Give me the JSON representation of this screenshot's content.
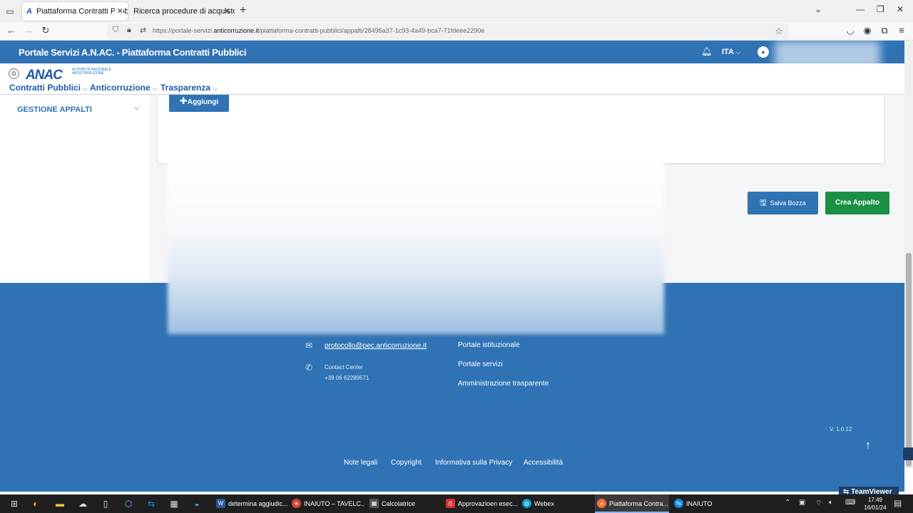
{
  "browser": {
    "tabs": [
      {
        "title": "Piattaforma Contratti Pubblici |",
        "active": true
      },
      {
        "title": "Ricerca procedure di acquisto",
        "active": false
      }
    ],
    "url_prefix": "https://portale-servizi.",
    "url_domain": "anticorruzione.it",
    "url_path": "/piattaforma-contratti-pubblici/appalti/28496a37-1c93-4a49-bca7-71fdeee2290e"
  },
  "header": {
    "title": "Portale Servizi A.N.AC. - Piattaforma Contratti Pubblici",
    "lang": "ITA"
  },
  "subheader": {
    "logo": "ANAC",
    "logo_sub": "AUTORITÀ NAZIONALE ANTICORRUZIONE",
    "menu": [
      "Contratti Pubblici",
      "Anticorruzione",
      "Trasparenza"
    ]
  },
  "sidebar": {
    "section": "GESTIONE APPALTI"
  },
  "main": {
    "add_button": "Aggiungi",
    "save_draft_button": "Salva Bozza",
    "create_button": "Crea Appalto"
  },
  "footer": {
    "email": "protocollo@pec.anticorruzione.it",
    "contact_label": "Contact Center",
    "contact_phone": "+39 06 62289571",
    "links": [
      "Portale istituzionale",
      "Portale servizi",
      "Amministrazione trasparente"
    ],
    "version": "V. 1.0.12",
    "bottom_links": [
      "Note legali",
      "Copyright",
      "Informativa sulla Privacy",
      "Accessibilità"
    ],
    "teamviewer": "TeamViewer"
  },
  "taskbar": {
    "apps": [
      {
        "label": "determina aggiudic...",
        "icon": "word-icon",
        "color": "#2b579a"
      },
      {
        "label": "INAIUTO – TAVELC...",
        "icon": "chrome-icon",
        "color": "#db4437"
      },
      {
        "label": "Calcolatrice",
        "icon": "calculator-icon",
        "color": "#555555"
      },
      {
        "label": "Approvazioen esec...",
        "icon": "pdf-icon",
        "color": "#d32f2f"
      },
      {
        "label": "Webex",
        "icon": "webex-icon",
        "color": "#00a0d1"
      },
      {
        "label": "Piattaforma Contra...",
        "icon": "firefox-icon",
        "color": "#ff7139"
      },
      {
        "label": "INAIUTO",
        "icon": "teamviewer-icon",
        "color": "#0e8ee9"
      }
    ],
    "time": "17:49",
    "date": "16/01/24"
  }
}
